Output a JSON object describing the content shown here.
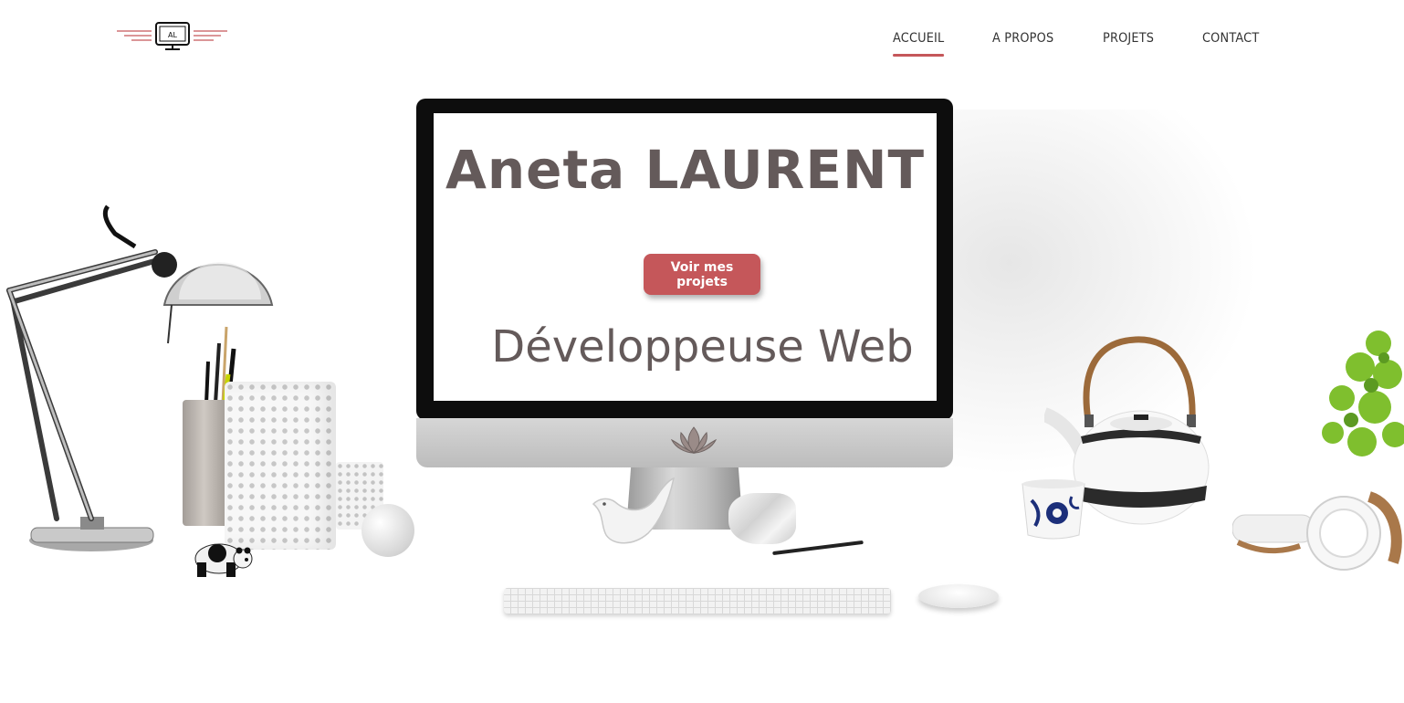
{
  "header": {
    "logo_text": "AL",
    "nav": [
      {
        "label": "ACCUEIL",
        "active": true
      },
      {
        "label": "A PROPOS",
        "active": false
      },
      {
        "label": "PROJETS",
        "active": false
      },
      {
        "label": "CONTACT",
        "active": false
      }
    ]
  },
  "hero": {
    "name": "Aneta LAURENT",
    "cta_label": "Voir mes projets",
    "subtitle": "Développeuse Web"
  },
  "colors": {
    "accent": "#c5575a",
    "heading_text": "#645a5a",
    "nav_text": "#333333",
    "background": "#ffffff"
  },
  "icons": {
    "logo": "computer-monitor-logo-icon",
    "monitor_chin": "lotus-icon"
  }
}
